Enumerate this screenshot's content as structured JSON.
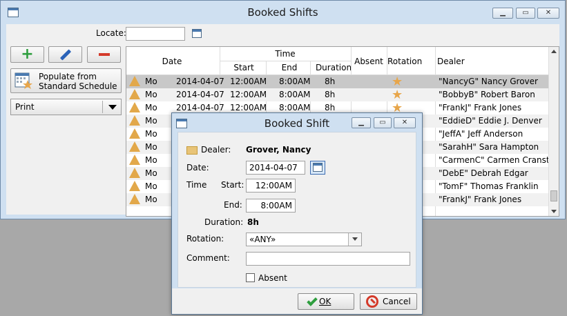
{
  "window": {
    "title": "Booked Shifts"
  },
  "locate": {
    "label": "Locate:",
    "value": ""
  },
  "toolbar": {
    "add": "add",
    "edit": "edit",
    "delete": "delete"
  },
  "populate": {
    "line1": "Populate from",
    "line2": "Standard Schedule"
  },
  "print": {
    "label": "Print"
  },
  "grid": {
    "headers": {
      "date": "Date",
      "time": "Time",
      "start": "Start",
      "end": "End",
      "duration": "Duration",
      "absent": "Absent",
      "rotation": "Rotation",
      "dealer": "Dealer"
    },
    "rows": [
      {
        "day": "Mo",
        "date": "2014-04-07",
        "start": "12:00AM",
        "end": "8:00AM",
        "duration": "8h",
        "rotation_star": true,
        "dealer": "\"NancyG\" Nancy Grover"
      },
      {
        "day": "Mo",
        "date": "2014-04-07",
        "start": "12:00AM",
        "end": "8:00AM",
        "duration": "8h",
        "rotation_star": true,
        "dealer": "\"BobbyB\" Robert Baron"
      },
      {
        "day": "Mo",
        "date": "2014-04-07",
        "start": "12:00AM",
        "end": "8:00AM",
        "duration": "8h",
        "rotation_star": true,
        "dealer": "\"FrankJ\" Frank Jones"
      },
      {
        "day": "Mo",
        "date": "",
        "start": "",
        "end": "",
        "duration": "",
        "rotation_star": false,
        "dealer": "\"EddieD\" Eddie J. Denver"
      },
      {
        "day": "Mo",
        "date": "",
        "start": "",
        "end": "",
        "duration": "",
        "rotation_star": false,
        "dealer": "\"JeffA\" Jeff Anderson"
      },
      {
        "day": "Mo",
        "date": "",
        "start": "",
        "end": "",
        "duration": "",
        "rotation_star": false,
        "dealer": "\"SarahH\" Sara Hampton"
      },
      {
        "day": "Mo",
        "date": "",
        "start": "",
        "end": "",
        "duration": "",
        "rotation_star": false,
        "dealer": "\"CarmenC\" Carmen Cranston"
      },
      {
        "day": "Mo",
        "date": "",
        "start": "",
        "end": "",
        "duration": "",
        "rotation_star": false,
        "dealer": "\"DebE\" Debrah Edgar"
      },
      {
        "day": "Mo",
        "date": "",
        "start": "",
        "end": "",
        "duration": "",
        "rotation_star": false,
        "dealer": "\"TomF\" Thomas Franklin"
      },
      {
        "day": "Mo",
        "date": "",
        "start": "",
        "end": "",
        "duration": "",
        "rotation_star": false,
        "dealer": "\"FrankJ\" Frank Jones"
      }
    ]
  },
  "dialog": {
    "title": "Booked Shift",
    "dealer_label": "Dealer:",
    "dealer_value": "Grover, Nancy",
    "date_label": "Date:",
    "date_value": "2014-04-07",
    "time_label": "Time",
    "start_label": "Start:",
    "start_value": "12:00AM",
    "end_label": "End:",
    "end_value": "8:00AM",
    "duration_label": "Duration:",
    "duration_value": "8h",
    "rotation_label": "Rotation:",
    "rotation_value": "«ANY»",
    "comment_label": "Comment:",
    "comment_value": "",
    "absent_label": "Absent",
    "ok_label": "OK",
    "cancel_label": "Cancel"
  },
  "colors": {
    "accent": "#e2a84a",
    "selection": "#c8c8c8",
    "frame": "#cfe0f1"
  }
}
